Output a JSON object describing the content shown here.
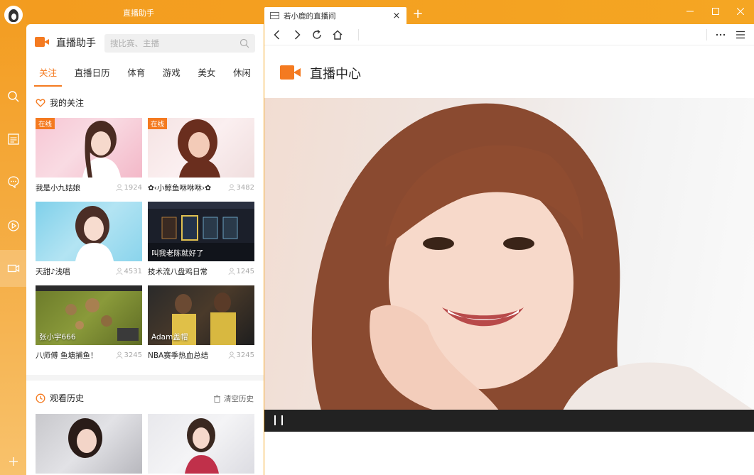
{
  "titlebar": {
    "app_title": "直播助手",
    "tab_label": "若小鹿的直播间",
    "new_tab": "+",
    "close": "×"
  },
  "rail": {
    "items": [
      "search-icon",
      "news-icon",
      "chat-icon",
      "play-icon",
      "camera-icon",
      "add-icon"
    ]
  },
  "panel": {
    "title": "直播助手",
    "search_placeholder": "搜比赛、主播",
    "categories": [
      "关注",
      "直播日历",
      "体育",
      "游戏",
      "美女",
      "休闲"
    ],
    "follow_title": "我的关注",
    "history_title": "观看历史",
    "clear_history": "清空历史",
    "cards": [
      {
        "name": "我是小九姑娘",
        "views": "1924",
        "badge": "在线",
        "overlay": ""
      },
      {
        "name": "✿‹小鲸鱼咻咻咻›✿",
        "views": "3482",
        "badge": "在线",
        "overlay": ""
      },
      {
        "name": "天甜♪浅唱",
        "views": "4531",
        "badge": "",
        "overlay": ""
      },
      {
        "name": "技术流八盘鸡日常",
        "views": "1245",
        "badge": "",
        "overlay": "叫我老陈就好了"
      },
      {
        "name": "八师傅 鱼塘捕鱼！",
        "views": "3245",
        "badge": "",
        "overlay": "张小宇666"
      },
      {
        "name": "NBA赛季热血总结",
        "views": "3245",
        "badge": "",
        "overlay": "Adam盖帽"
      }
    ]
  },
  "browser": {
    "live_title": "直播中心"
  },
  "colors": {
    "accent": "#f47a20",
    "titlebar": "#f5a623"
  }
}
